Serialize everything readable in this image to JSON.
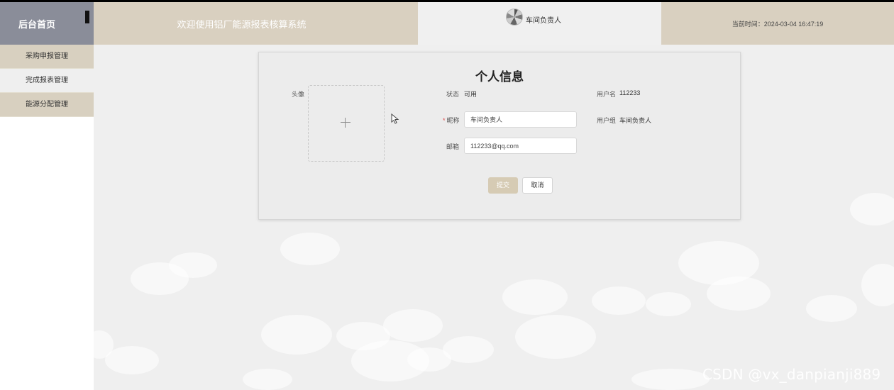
{
  "sidebar": {
    "title": "后台首页",
    "items": [
      {
        "label": "采购申报管理"
      },
      {
        "label": "完成报表管理"
      },
      {
        "label": "能源分配管理"
      }
    ]
  },
  "header": {
    "welcome": "欢迎使用铝厂能源报表核算系统",
    "username": "车间负责人",
    "time": "当前时间：2024-03-04 16:47:19"
  },
  "form": {
    "title": "个人信息",
    "avatar_label": "头像",
    "status_label": "状态",
    "status_value": "可用",
    "nickname_label": "昵称",
    "nickname_value": "车间负责人",
    "email_label": "邮箱",
    "email_value": "112233@qq.com",
    "username_label": "用户名",
    "username_value": "112233",
    "group_label": "用户组",
    "group_value": "车间负责人",
    "submit_label": "提交",
    "cancel_label": "取消"
  },
  "colors": {
    "header_tan": "#d9d0c0",
    "sidebar_head": "#8a8d99",
    "submit_button": "#d6cbb4",
    "required_star": "#e04848"
  },
  "icons": {
    "upload": "plus-icon",
    "collapse": "collapse-bar-icon",
    "cursor": "mouse-cursor-icon"
  },
  "watermark": "CSDN @vx_danpianji889"
}
